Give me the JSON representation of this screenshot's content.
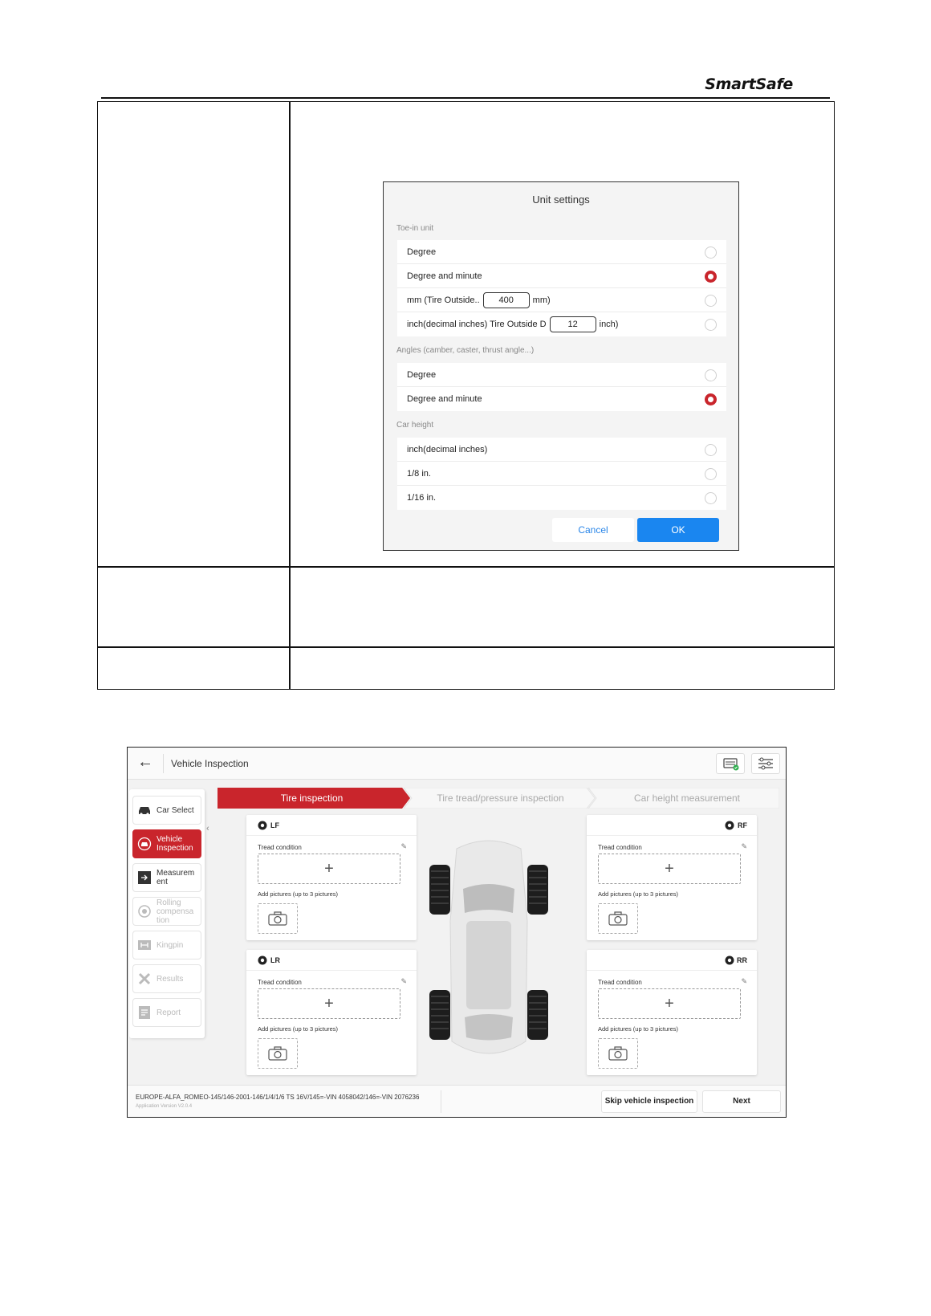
{
  "header": {
    "brand": "SmartSafe"
  },
  "unit_settings": {
    "title": "Unit settings",
    "toe_in_section": "Toe-in unit",
    "toe_in_options": [
      {
        "label": "Degree",
        "selected": false
      },
      {
        "label": "Degree and minute",
        "selected": true
      },
      {
        "label_before": "mm (Tire Outside..",
        "value": "400",
        "label_after": "mm)",
        "selected": false
      },
      {
        "label_before": "inch(decimal inches) Tire Outside D",
        "value": "12",
        "label_after": "inch)",
        "selected": false
      }
    ],
    "angles_section": "Angles (camber, caster, thrust angle...)",
    "angle_options": [
      {
        "label": "Degree",
        "selected": false
      },
      {
        "label": "Degree and minute",
        "selected": true
      }
    ],
    "car_height_section": "Car height",
    "car_height_options": [
      {
        "label": "inch(decimal inches)",
        "selected": false
      },
      {
        "label": "1/8 in.",
        "selected": false
      },
      {
        "label": "1/16 in.",
        "selected": false
      }
    ],
    "cancel_label": "Cancel",
    "ok_label": "OK",
    "accent_color": "#c9252c",
    "ok_color": "#1a86f0"
  },
  "app": {
    "title": "Vehicle Inspection",
    "back_icon": "back-arrow-icon",
    "sidebar": [
      {
        "label": "Car Select",
        "icon": "car-icon",
        "state": "normal"
      },
      {
        "label": "Vehicle Inspection",
        "icon": "car-inspect-icon",
        "state": "active"
      },
      {
        "label": "Measurem ent",
        "icon": "measurement-icon",
        "state": "normal"
      },
      {
        "label": "Rolling compensa tion",
        "icon": "rolling-icon",
        "state": "disabled"
      },
      {
        "label": "Kingpin",
        "icon": "kingpin-icon",
        "state": "disabled"
      },
      {
        "label": "Results",
        "icon": "results-icon",
        "state": "disabled"
      },
      {
        "label": "Report",
        "icon": "report-icon",
        "state": "disabled"
      }
    ],
    "steps": [
      {
        "label": "Tire inspection",
        "active": true
      },
      {
        "label": "Tire tread/pressure inspection",
        "active": false
      },
      {
        "label": "Car height measurement",
        "active": false
      }
    ],
    "tires": [
      {
        "position": "LF"
      },
      {
        "position": "RF"
      },
      {
        "position": "LR"
      },
      {
        "position": "RR"
      }
    ],
    "tread_label": "Tread condition",
    "add_pictures_label": "Add pictures (up to 3 pictures)",
    "plus": "+",
    "vehicle_info": "EUROPE-ALFA_ROMEO-145/146-2001-146/1/4/1/6 TS 16V/145=-VIN 4058042/146=-VIN 2076236",
    "app_version": "Application Version V2.0.4",
    "skip_label": "Skip vehicle inspection",
    "next_label": "Next"
  }
}
